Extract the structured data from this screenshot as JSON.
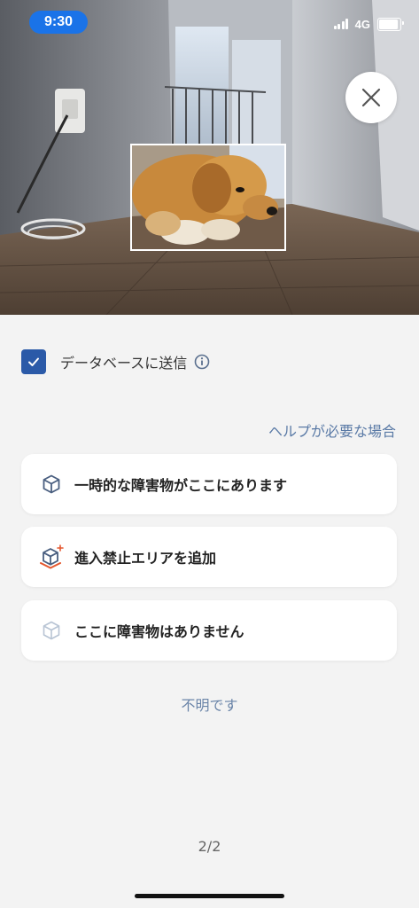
{
  "status_bar": {
    "time": "9:30",
    "network": "4G",
    "battery_level": 0.9
  },
  "photo": {
    "subject": "dog"
  },
  "close_button": {
    "icon": "close-icon"
  },
  "database": {
    "checked": true,
    "label": "データベースに送信",
    "info_icon": "info-icon"
  },
  "help_link": "ヘルプが必要な場合",
  "options": [
    {
      "label": "一時的な障害物がここにあります",
      "icon": "cube-icon"
    },
    {
      "label": "進入禁止エリアを追加",
      "icon": "cube-add-zone-icon"
    },
    {
      "label": "ここに障害物はありません",
      "icon": "cube-outline-icon"
    }
  ],
  "unknown_link": "不明です",
  "pager": "2/2",
  "colors": {
    "accent": "#2b5aa8",
    "link": "#5a7aa6",
    "time_pill": "#1a73e8",
    "warning": "#e4572e"
  }
}
